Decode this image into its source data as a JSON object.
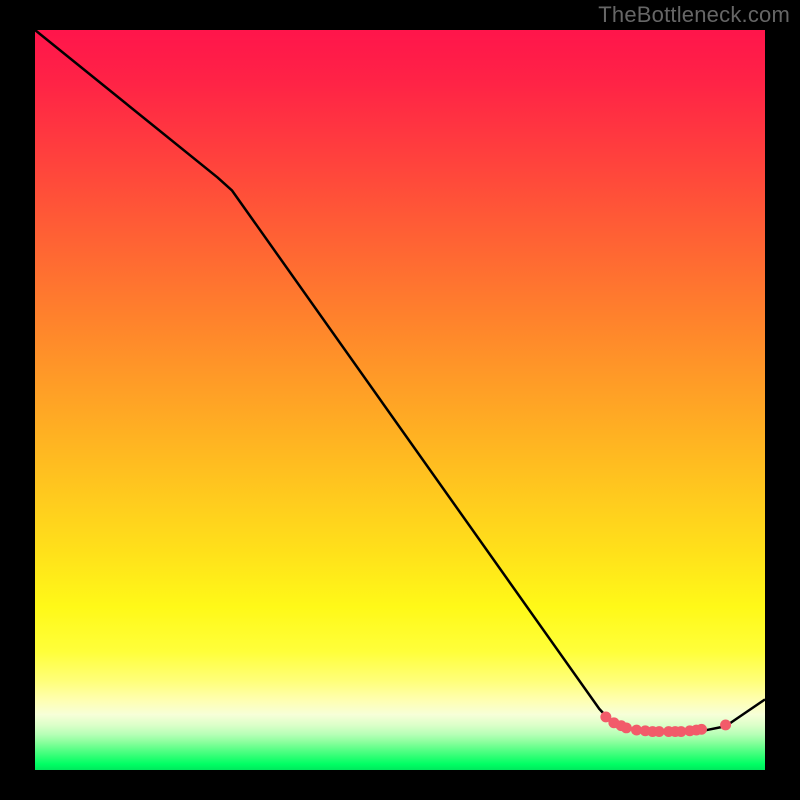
{
  "attribution": "TheBottleneck.com",
  "gradient_stops": [
    {
      "pos": 0.0,
      "color": "#ff154b"
    },
    {
      "pos": 0.07,
      "color": "#ff2346"
    },
    {
      "pos": 0.15,
      "color": "#ff3a3f"
    },
    {
      "pos": 0.23,
      "color": "#ff5238"
    },
    {
      "pos": 0.31,
      "color": "#ff6a32"
    },
    {
      "pos": 0.39,
      "color": "#ff822c"
    },
    {
      "pos": 0.47,
      "color": "#ff9a27"
    },
    {
      "pos": 0.55,
      "color": "#ffb222"
    },
    {
      "pos": 0.63,
      "color": "#ffca1e"
    },
    {
      "pos": 0.71,
      "color": "#ffe21a"
    },
    {
      "pos": 0.78,
      "color": "#fff918"
    },
    {
      "pos": 0.84,
      "color": "#ffff3a"
    },
    {
      "pos": 0.88,
      "color": "#ffff7a"
    },
    {
      "pos": 0.905,
      "color": "#ffffb0"
    },
    {
      "pos": 0.925,
      "color": "#f7ffd8"
    },
    {
      "pos": 0.94,
      "color": "#daffc8"
    },
    {
      "pos": 0.952,
      "color": "#b6ffb6"
    },
    {
      "pos": 0.962,
      "color": "#8cff9e"
    },
    {
      "pos": 0.972,
      "color": "#5cff88"
    },
    {
      "pos": 0.982,
      "color": "#2eff74"
    },
    {
      "pos": 0.992,
      "color": "#00ff64"
    },
    {
      "pos": 1.0,
      "color": "#00e85d"
    }
  ],
  "chart_data": {
    "type": "line",
    "title": "",
    "xlabel": "",
    "ylabel": "",
    "xlim": [
      0,
      100
    ],
    "ylim": [
      0,
      100
    ],
    "note": "x and y read in plot-area percentage units (0 = left/top of colored area, 100 = right/bottom). The line descends from top-left to a flat bottom stretch then rises slightly at far right. Pink markers highlight the bottom flat segment.",
    "series": [
      {
        "name": "curve",
        "x": [
          0.0,
          25.0,
          27.0,
          77.3,
          78.5,
          80.0,
          82.0,
          84.0,
          86.0,
          88.0,
          90.0,
          92.0,
          94.0,
          95.0,
          100.0
        ],
        "y": [
          0.0,
          20.2,
          22.0,
          93.0,
          94.3,
          95.2,
          95.8,
          96.1,
          96.2,
          96.2,
          96.1,
          95.9,
          95.5,
          95.1,
          91.7
        ]
      }
    ],
    "markers": {
      "name": "highlight-dots",
      "color": "#f25b6a",
      "x": [
        78.2,
        79.3,
        80.3,
        81.0,
        82.4,
        83.6,
        84.6,
        85.5,
        86.8,
        87.7,
        88.5,
        89.7,
        90.6,
        91.3,
        94.6
      ],
      "y": [
        94.1,
        94.9,
        95.3,
        95.6,
        95.9,
        96.0,
        96.1,
        96.1,
        96.1,
        96.1,
        96.1,
        96.0,
        95.9,
        95.8,
        95.2
      ]
    }
  }
}
